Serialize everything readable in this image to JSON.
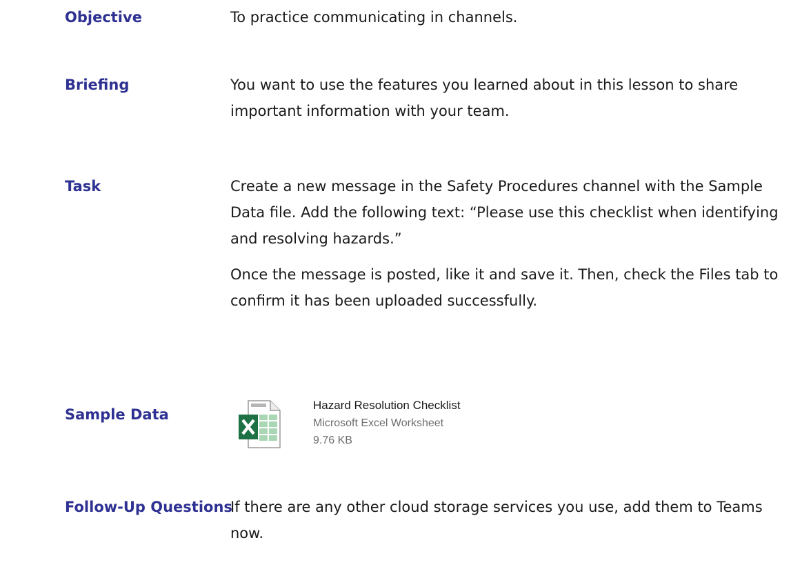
{
  "rows": {
    "objective": {
      "label": "Objective",
      "text": "To practice communicating in channels."
    },
    "briefing": {
      "label": "Briefing",
      "text": "You want to use the features you learned about in this lesson to share important information with your team."
    },
    "task": {
      "label": "Task",
      "paragraph1": "Create a new message in the Safety Procedures channel with the Sample Data file. Add the following text: “Please use this checklist when identifying and resolving hazards.”",
      "paragraph2": "Once the message is posted, like it and save it. Then, check the Files tab to confirm it has been uploaded successfully."
    },
    "sample_data": {
      "label": "Sample Data",
      "file": {
        "name": "Hazard Resolution Checklist",
        "type": "Microsoft Excel Worksheet",
        "size": "9.76 KB",
        "icon": "excel-file-icon"
      }
    },
    "follow_up": {
      "label": "Follow-Up Questions",
      "text": "If there are any other cloud storage services you use, add them to Teams now."
    }
  },
  "colors": {
    "label": "#2e3192",
    "excel_green": "#1e7145"
  }
}
